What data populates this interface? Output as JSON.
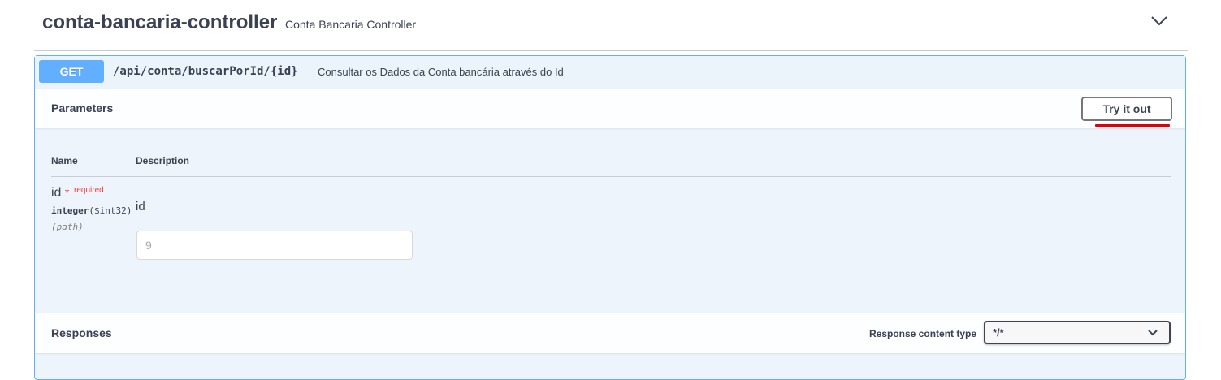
{
  "tag": {
    "title": "conta-bancaria-controller",
    "description": "Conta Bancaria Controller"
  },
  "operation": {
    "method": "GET",
    "path": "/api/conta/buscarPorId/{id}",
    "summary": "Consultar os Dados da Conta bancária através do Id"
  },
  "parameters": {
    "title": "Parameters",
    "try_label": "Try it out",
    "header_name": "Name",
    "header_description": "Description",
    "items": [
      {
        "name": "id",
        "required_star": "*",
        "required_label": "required",
        "type": "integer",
        "format": "($int32)",
        "in": "(path)",
        "description": "id",
        "placeholder": "9"
      }
    ]
  },
  "responses": {
    "title": "Responses",
    "content_type_label": "Response content type",
    "content_type_value": "*/*"
  },
  "colors": {
    "get": "#61affe",
    "highlight": "#e0000c"
  }
}
